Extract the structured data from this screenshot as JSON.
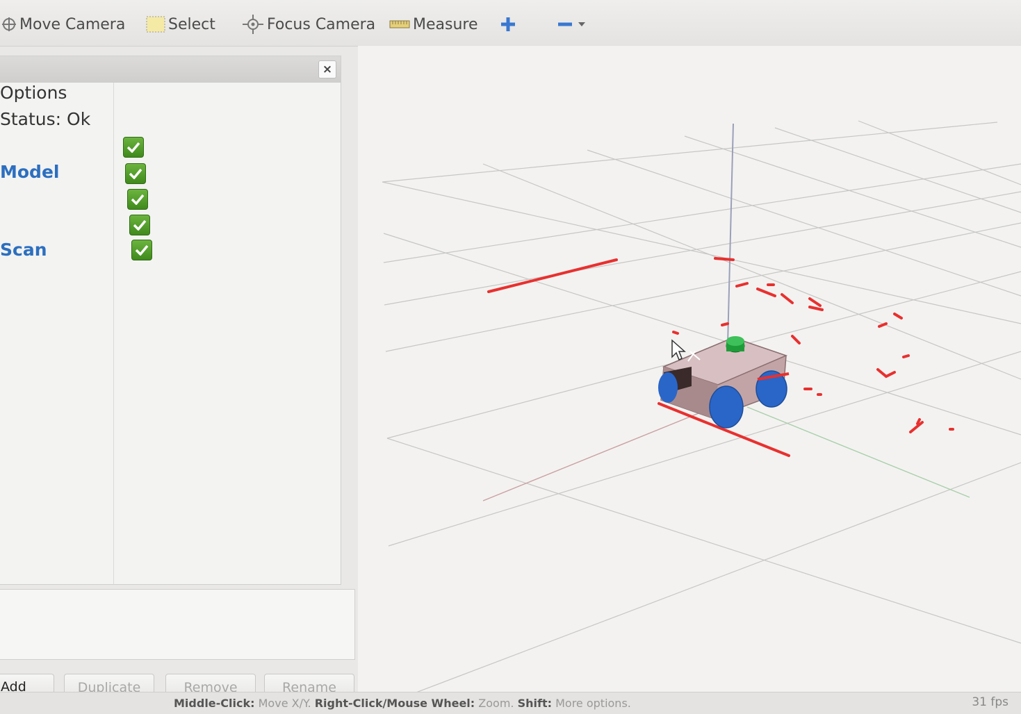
{
  "toolbar": {
    "move_camera": "Move Camera",
    "select": "Select",
    "focus_camera": "Focus Camera",
    "measure": "Measure",
    "add_tool_icon": "plus-icon",
    "remove_tool_icon": "minus-icon"
  },
  "displays_panel": {
    "close_glyph": "×",
    "rows": [
      {
        "label": "Options",
        "style": "plain"
      },
      {
        "label": "Status: Ok",
        "style": "plain"
      },
      {
        "label": "",
        "checked": true
      },
      {
        "label": "Model",
        "style": "blue",
        "checked": true
      },
      {
        "label": "",
        "checked": true
      },
      {
        "label": "",
        "checked": true
      },
      {
        "label": "Scan",
        "style": "blue",
        "checked": true
      }
    ]
  },
  "buttons": {
    "add": "Add",
    "duplicate": "Duplicate",
    "remove": "Remove",
    "rename": "Rename"
  },
  "status": {
    "hint_key_1": "Middle-Click:",
    "hint_val_1": "Move X/Y.",
    "hint_key_2": "Right-Click/Mouse Wheel:",
    "hint_val_2": "Zoom.",
    "hint_key_3": "Shift:",
    "hint_val_3": "More options.",
    "fps": "31 fps"
  },
  "colors": {
    "laser_scan": "#e8302e",
    "wheels": "#2a66c8",
    "chassis": "#b8989a",
    "sensor": "#1f9c3a",
    "checkbox": "#4e9a26",
    "link_text": "#2c6fbf"
  }
}
